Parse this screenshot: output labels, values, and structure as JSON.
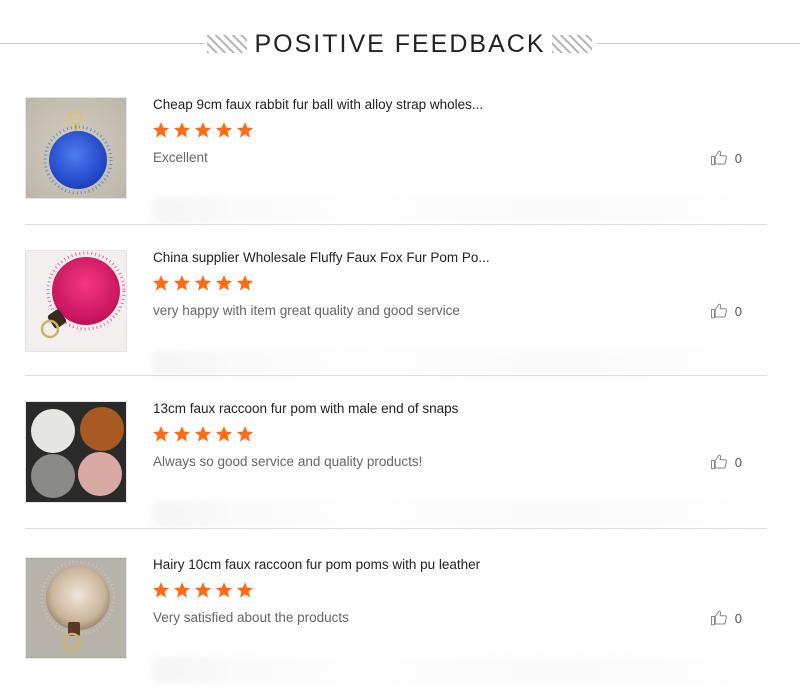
{
  "header": {
    "title": "POSITIVE FEEDBACK"
  },
  "colors": {
    "star": "#ff6a14",
    "divider": "#dedede",
    "accent_rabbit": "#2f5bdc",
    "accent_fox": "#e0186f"
  },
  "reviews": [
    {
      "title": "Cheap 9cm faux rabbit fur ball with alloy strap wholes...",
      "rating": 5,
      "comment": "Excellent",
      "likes": "0",
      "thumb_icon": "blue-fur-ball-keychain"
    },
    {
      "title": "China supplier Wholesale Fluffy Faux Fox Fur Pom Po...",
      "rating": 5,
      "comment": "very happy with item great quality and good service",
      "likes": "0",
      "thumb_icon": "pink-fur-pom-keychain"
    },
    {
      "title": "13cm faux raccoon fur pom with male end of snaps",
      "rating": 5,
      "comment": "Always so good service and quality products!",
      "likes": "0",
      "thumb_icon": "four-fur-poms"
    },
    {
      "title": "Hairy 10cm faux raccoon fur pom poms with pu leather",
      "rating": 5,
      "comment": "Very satisfied about the products",
      "likes": "0",
      "thumb_icon": "beige-raccoon-pom-keychain"
    }
  ]
}
